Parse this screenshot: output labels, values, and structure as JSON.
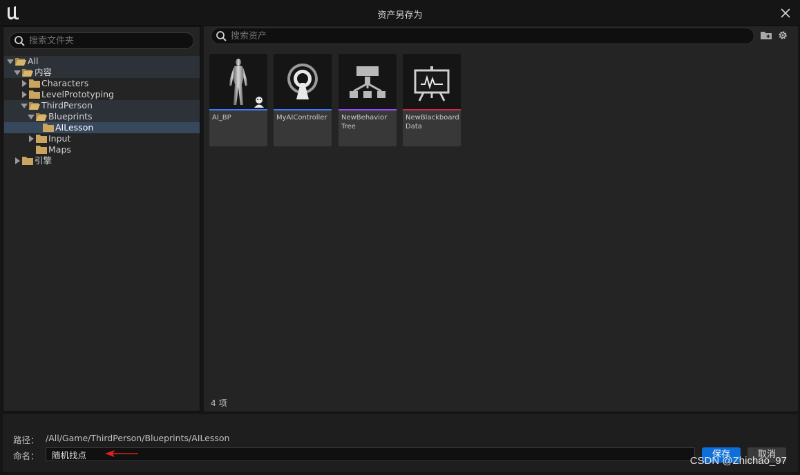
{
  "window": {
    "title": "资产另存为"
  },
  "folder_panel": {
    "search_placeholder": "搜索文件夹",
    "tree": [
      {
        "label": "All",
        "indent": 0,
        "expanded": true
      },
      {
        "label": "内容",
        "indent": 1,
        "expanded": true
      },
      {
        "label": "Characters",
        "indent": 2,
        "expanded": false
      },
      {
        "label": "LevelPrototyping",
        "indent": 2,
        "expanded": false
      },
      {
        "label": "ThirdPerson",
        "indent": 2,
        "expanded": true
      },
      {
        "label": "Blueprints",
        "indent": 3,
        "expanded": true
      },
      {
        "label": "AILesson",
        "indent": 4,
        "selected": true
      },
      {
        "label": "Input",
        "indent": 3,
        "expanded": false
      },
      {
        "label": "Maps",
        "indent": 3
      },
      {
        "label": "引擎",
        "indent": 1,
        "expanded": false
      }
    ]
  },
  "asset_panel": {
    "search_placeholder": "搜索资产",
    "assets": [
      {
        "name": "AI_BP",
        "bar_color": "#3f7dff",
        "icon": "character-mannequin-icon"
      },
      {
        "name": "MyAIController",
        "bar_color": "#3f7dff",
        "icon": "ai-controller-icon"
      },
      {
        "name": "NewBehavior Tree",
        "bar_color": "#9b4cff",
        "icon": "behavior-tree-icon"
      },
      {
        "name": "NewBlackboard Data",
        "bar_color": "#d4274f",
        "icon": "blackboard-icon"
      }
    ],
    "item_count": "4 项"
  },
  "footer": {
    "path_label": "路径：",
    "path_value": "/All/Game/ThirdPerson/Blueprints/AILesson",
    "name_label": "命名：",
    "name_value": "随机找点",
    "save_label": "保存",
    "cancel_label": "取消"
  },
  "watermark": "CSDN @Zhichao_97",
  "colors": {
    "accent": "#0e6fd8",
    "selection": "#38485c",
    "folder": "#c9a560"
  }
}
